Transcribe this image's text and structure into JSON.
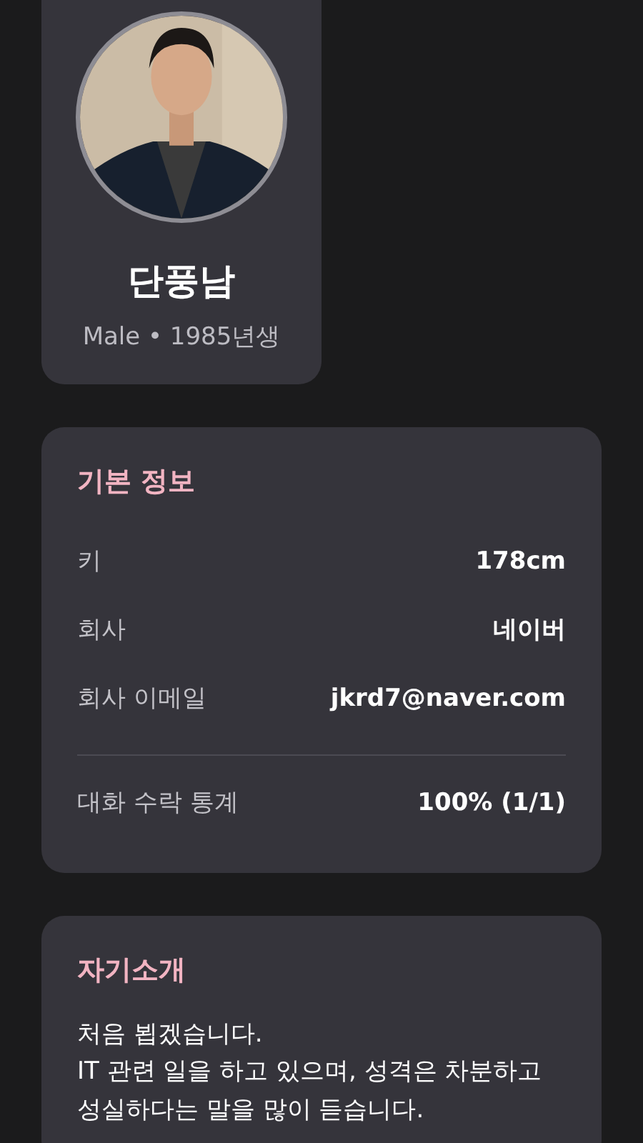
{
  "profile": {
    "name": "단풍남",
    "subtitle": "Male • 1985년생"
  },
  "basic_info": {
    "title": "기본 정보",
    "rows": [
      {
        "label": "키",
        "value": "178cm"
      },
      {
        "label": "회사",
        "value": "네이버"
      },
      {
        "label": "회사 이메일",
        "value": "jkrd7@naver.com"
      }
    ],
    "stats": {
      "label": "대화 수락 통계",
      "value": "100% (1/1)"
    }
  },
  "introduction": {
    "title": "자기소개",
    "text": "처음 뵙겠습니다.\nIT 관련 일을 하고 있으며, 성격은 차분하고\n성실하다는 말을 많이 듣습니다."
  }
}
